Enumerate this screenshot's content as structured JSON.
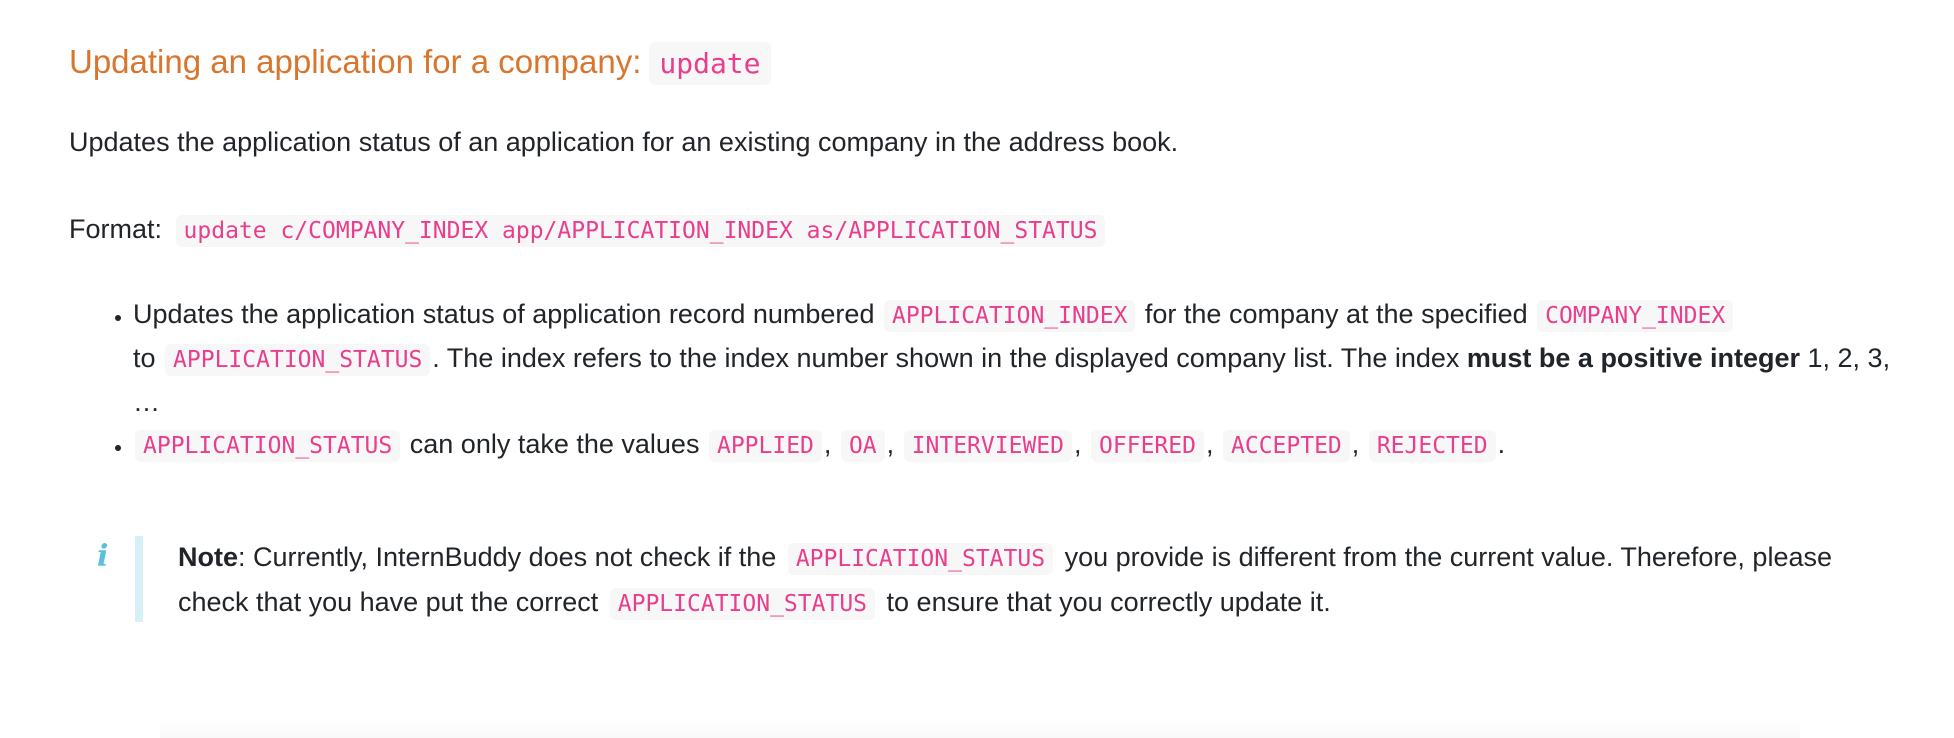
{
  "section": {
    "title": "Updating an application for a company:",
    "command": "update"
  },
  "description": "Updates the application status of an application for an existing company in the address book.",
  "format": {
    "label": "Format:",
    "syntax": "update c/COMPANY_INDEX app/APPLICATION_INDEX as/APPLICATION_STATUS"
  },
  "rules": {
    "item1": {
      "t1": "Updates the application status of application record numbered",
      "c1": "APPLICATION_INDEX",
      "t2": "for the company at the specified",
      "c2": "COMPANY_INDEX",
      "t3": "to",
      "c3": "APPLICATION_STATUS",
      "t4": ". The index refers to the index number shown in the displayed company list. The index",
      "bold": "must be a positive integer",
      "t5": "1, 2, 3, …"
    },
    "item2": {
      "c1": "APPLICATION_STATUS",
      "t1": "can only take the values",
      "values": [
        "APPLIED",
        "OA",
        "INTERVIEWED",
        "OFFERED",
        "ACCEPTED",
        "REJECTED"
      ],
      "sep": ",",
      "end": "."
    }
  },
  "note": {
    "icon": "info-icon",
    "label": "Note",
    "t1": ": Currently, InternBuddy does not check if the",
    "c1": "APPLICATION_STATUS",
    "t2": "you provide is different from the current value. Therefore, please check that you have put the correct",
    "c2": "APPLICATION_STATUS",
    "t3": "to ensure that you correctly update it."
  },
  "colors": {
    "heading": "#d9762e",
    "code_text": "#e83e8c",
    "code_bg": "#f7f7f7",
    "note_icon": "#5bc0de",
    "note_bar": "#d6f0f8",
    "body_text": "#212529"
  }
}
